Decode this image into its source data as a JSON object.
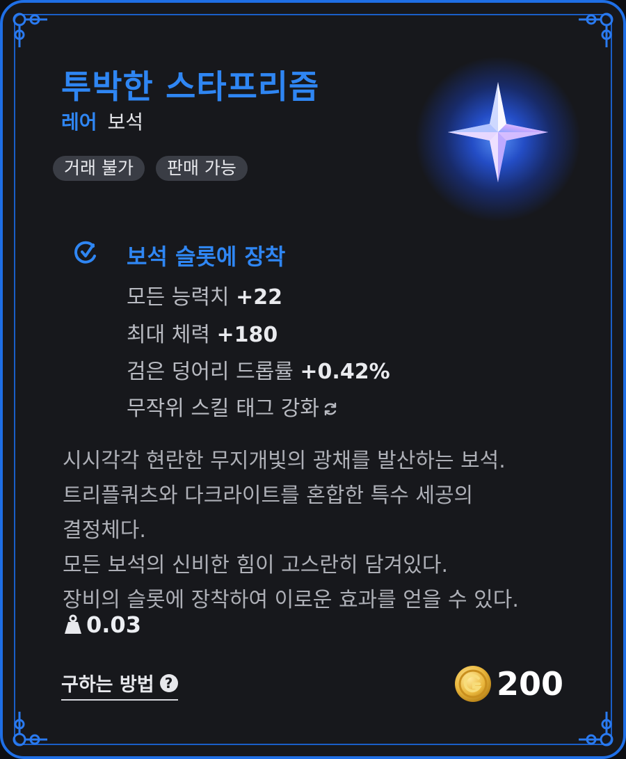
{
  "item": {
    "name": "투박한 스타프리즘",
    "rarity": "레어",
    "type": "보석",
    "tags": [
      "거래 불가",
      "판매 가능"
    ],
    "icon": "star-prism-gem-icon"
  },
  "effect": {
    "title": "보석 슬롯에 장착",
    "stats": [
      {
        "label": "모든 능력치",
        "value": "+22"
      },
      {
        "label": "최대 체력",
        "value": "+180"
      },
      {
        "label": "검은 덩어리 드롭률",
        "value": "+0.42%"
      },
      {
        "label": "무작위 스킬 태그 강화",
        "value": ""
      }
    ]
  },
  "description": [
    "시시각각 현란한 무지개빛의 광채를 발산하는 보석.",
    "트리플쿼츠와 다크라이트를 혼합한 특수 세공의",
    "결정체다.",
    "모든 보석의 신비한 힘이 고스란히 담겨있다.",
    "장비의 슬롯에 장착하여 이로운 효과를 얻을 수 있다."
  ],
  "weight": "0.03",
  "footer": {
    "how_to_obtain": "구하는 방법",
    "price": "200"
  },
  "colors": {
    "accent": "#2f86f3",
    "border": "#1f6fe6",
    "background": "#17181c"
  }
}
